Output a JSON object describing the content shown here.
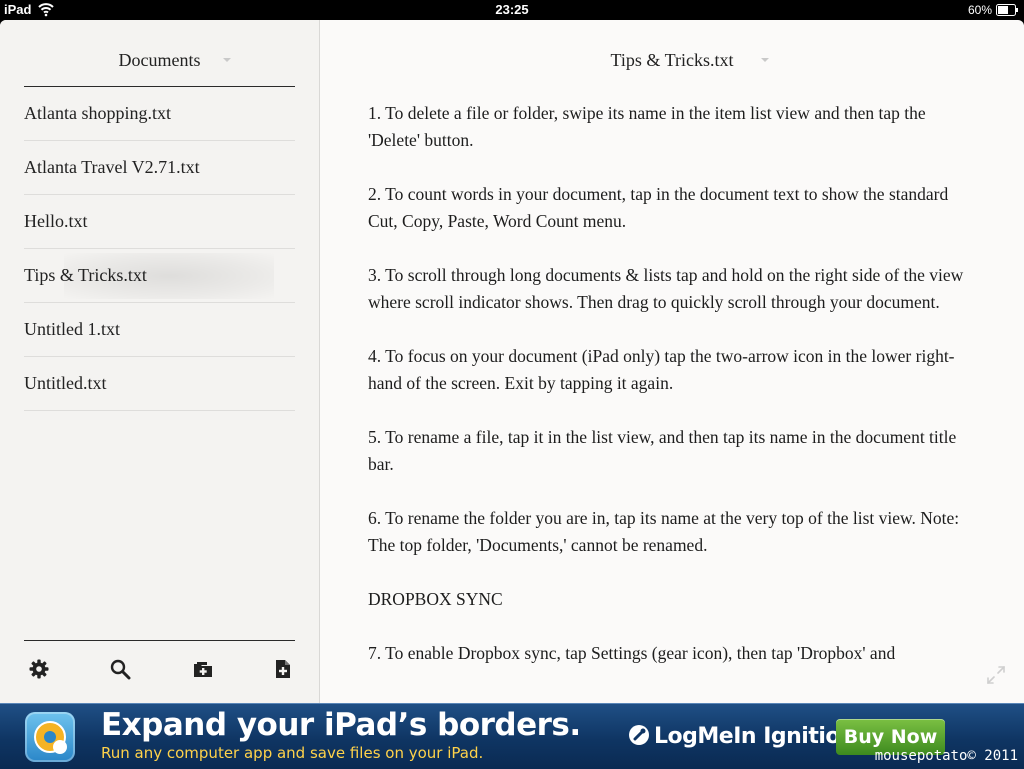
{
  "status_bar": {
    "carrier": "iPad",
    "time": "23:25",
    "battery": "60%"
  },
  "sidebar": {
    "title": "Documents",
    "files": [
      "Atlanta shopping.txt",
      "Atlanta Travel V2.71.txt",
      "Hello.txt",
      "Tips & Tricks.txt",
      "Untitled 1.txt",
      "Untitled.txt"
    ],
    "selected_index": 3,
    "toolbar": {
      "settings_icon": "gear-icon",
      "search_icon": "search-icon",
      "new_folder_icon": "new-folder-icon",
      "new_document_icon": "new-document-icon"
    }
  },
  "document": {
    "title": "Tips & Tricks.txt",
    "paragraphs": [
      "1. To delete a file or folder, swipe its name in the item list view and then tap the 'Delete' button.",
      "2. To count words in your document, tap in the document text to show the standard Cut, Copy, Paste, Word Count menu.",
      "3. To scroll through long documents & lists tap and hold on the right side of the view where scroll indicator shows. Then drag to quickly scroll through your document.",
      "4. To focus on your document (iPad only) tap the two-arrow icon in the lower right-hand of the screen. Exit by tapping it again.",
      "5. To rename a file, tap it in the list view, and then tap its name in the document title bar.",
      "6. To rename the folder you are in, tap its name at the very top of the list view. Note: The top folder, 'Documents,' cannot be renamed.",
      "DROPBOX SYNC",
      "7. To enable Dropbox sync, tap Settings (gear icon), then tap 'Dropbox' and"
    ]
  },
  "ad": {
    "headline": "Expand your iPad’s borders.",
    "subline": "Run any computer app and save files on your iPad.",
    "brand": "LogMeIn Ignition",
    "button": "Buy Now",
    "credit": "mousepotato© 2011"
  },
  "colors": {
    "sidebar_bg": "#f4f3f1",
    "document_bg": "#fbfaf9",
    "ad_bg": "#0f3563",
    "ad_subline": "#ffd24a",
    "buy_button": "#5aa52f"
  }
}
